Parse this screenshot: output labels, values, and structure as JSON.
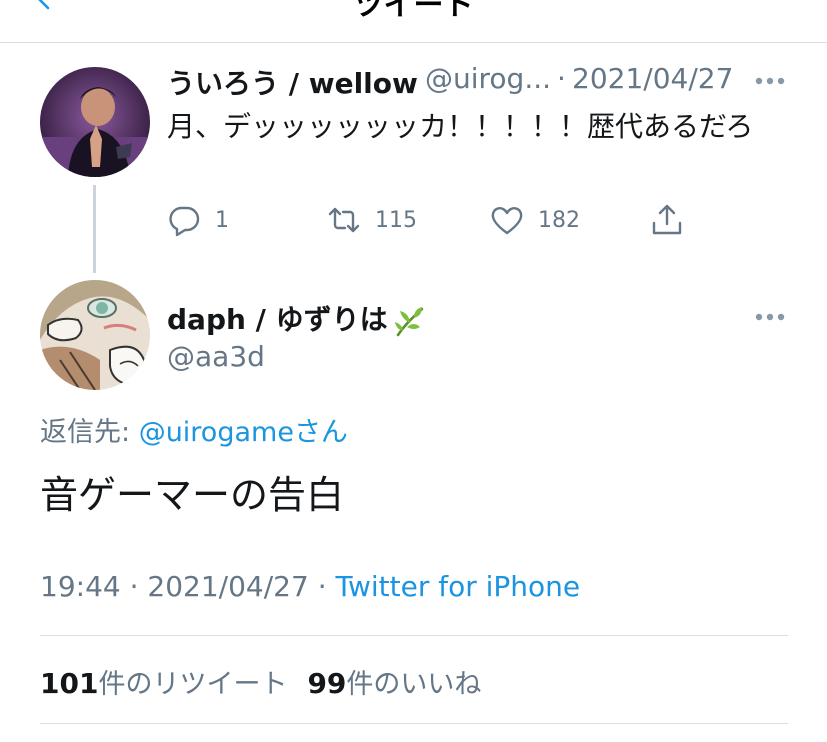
{
  "header": {
    "title": "ツイート"
  },
  "parent_tweet": {
    "name": "ういろう / wellow",
    "handle": "@uirog...",
    "separator": "·",
    "date": "2021/04/27",
    "text": "月、デッッッッッッカ！！！！！歴代あるだろ",
    "actions": {
      "reply_count": "1",
      "retweet_count": "115",
      "like_count": "182"
    }
  },
  "main_tweet": {
    "name": "daph / ゆずりは",
    "handle": "@aa3d",
    "reply_prefix": "返信先: ",
    "reply_mention": "@uirogame",
    "reply_suffix": "さん",
    "text": "音ゲーマーの告白",
    "time": "19:44",
    "date": "2021/04/27",
    "separator": " · ",
    "source": "Twitter for iPhone",
    "retweets": {
      "count": "101",
      "label": "件のリツイート"
    },
    "likes": {
      "count": "99",
      "label": "件のいいね"
    }
  },
  "colors": {
    "accent": "#1b95e0",
    "muted": "#657786",
    "text": "#14171a"
  }
}
